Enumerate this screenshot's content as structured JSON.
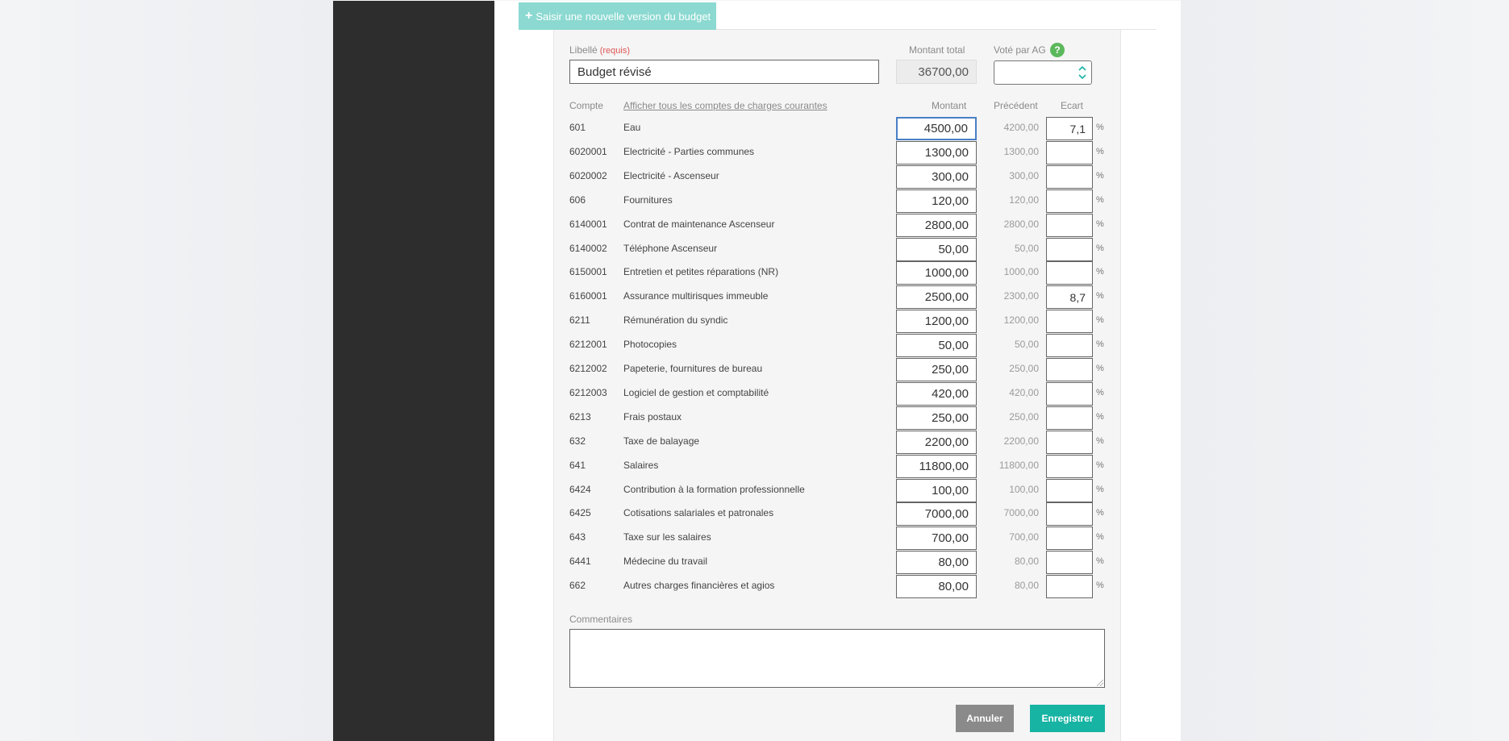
{
  "toolbar": {
    "new_version_label": "Saisir une nouvelle version du budget",
    "plus_glyph": "+"
  },
  "form": {
    "libelle_label": "Libellé",
    "required_label": "(requis)",
    "libelle_value": "Budget révisé",
    "total_label": "Montant total",
    "total_value": "36700,00",
    "voted_label": "Voté par AG",
    "voted_value": "",
    "help_glyph": "?"
  },
  "table": {
    "col_compte": "Compte",
    "show_all_link": "Afficher tous les comptes de charges courantes",
    "col_montant": "Montant",
    "col_precedent": "Précédent",
    "col_ecart": "Ecart",
    "pct_symbol": "%",
    "rows": [
      {
        "code": "601",
        "label": "Eau",
        "amount": "4500,00",
        "previous": "4200,00",
        "ecart": "7,1"
      },
      {
        "code": "6020001",
        "label": "Electricité - Parties communes",
        "amount": "1300,00",
        "previous": "1300,00",
        "ecart": ""
      },
      {
        "code": "6020002",
        "label": "Electricité - Ascenseur",
        "amount": "300,00",
        "previous": "300,00",
        "ecart": ""
      },
      {
        "code": "606",
        "label": "Fournitures",
        "amount": "120,00",
        "previous": "120,00",
        "ecart": ""
      },
      {
        "code": "6140001",
        "label": "Contrat de maintenance Ascenseur",
        "amount": "2800,00",
        "previous": "2800,00",
        "ecart": ""
      },
      {
        "code": "6140002",
        "label": "Téléphone Ascenseur",
        "amount": "50,00",
        "previous": "50,00",
        "ecart": ""
      },
      {
        "code": "6150001",
        "label": "Entretien et petites réparations (NR)",
        "amount": "1000,00",
        "previous": "1000,00",
        "ecart": ""
      },
      {
        "code": "6160001",
        "label": "Assurance multirisques immeuble",
        "amount": "2500,00",
        "previous": "2300,00",
        "ecart": "8,7"
      },
      {
        "code": "6211",
        "label": "Rémunération du syndic",
        "amount": "1200,00",
        "previous": "1200,00",
        "ecart": ""
      },
      {
        "code": "6212001",
        "label": "Photocopies",
        "amount": "50,00",
        "previous": "50,00",
        "ecart": ""
      },
      {
        "code": "6212002",
        "label": "Papeterie, fournitures de bureau",
        "amount": "250,00",
        "previous": "250,00",
        "ecart": ""
      },
      {
        "code": "6212003",
        "label": "Logiciel de gestion et comptabilité",
        "amount": "420,00",
        "previous": "420,00",
        "ecart": ""
      },
      {
        "code": "6213",
        "label": "Frais postaux",
        "amount": "250,00",
        "previous": "250,00",
        "ecart": ""
      },
      {
        "code": "632",
        "label": "Taxe de balayage",
        "amount": "2200,00",
        "previous": "2200,00",
        "ecart": ""
      },
      {
        "code": "641",
        "label": "Salaires",
        "amount": "11800,00",
        "previous": "11800,00",
        "ecart": ""
      },
      {
        "code": "6424",
        "label": "Contribution à la formation professionnelle",
        "amount": "100,00",
        "previous": "100,00",
        "ecart": ""
      },
      {
        "code": "6425",
        "label": "Cotisations salariales et patronales",
        "amount": "7000,00",
        "previous": "7000,00",
        "ecart": ""
      },
      {
        "code": "643",
        "label": "Taxe sur les salaires",
        "amount": "700,00",
        "previous": "700,00",
        "ecart": ""
      },
      {
        "code": "6441",
        "label": "Médecine du travail",
        "amount": "80,00",
        "previous": "80,00",
        "ecart": ""
      },
      {
        "code": "662",
        "label": "Autres charges financières et agios",
        "amount": "80,00",
        "previous": "80,00",
        "ecart": ""
      }
    ]
  },
  "comments": {
    "label": "Commentaires",
    "value": ""
  },
  "actions": {
    "cancel_label": "Annuler",
    "save_label": "Enregistrer"
  },
  "colors": {
    "accent": "#17b3a3",
    "accent_light": "#8bd9d1",
    "sidebar": "#2d2d2d",
    "cancel": "#8a8a8a",
    "focus": "#4a7fc6",
    "help": "#5cb85c",
    "required": "#e05555"
  },
  "icons": {
    "add": "plus-icon",
    "help": "help-icon",
    "select_arrows": "chevron-updown-icon",
    "resize": "resize-grip-icon"
  }
}
